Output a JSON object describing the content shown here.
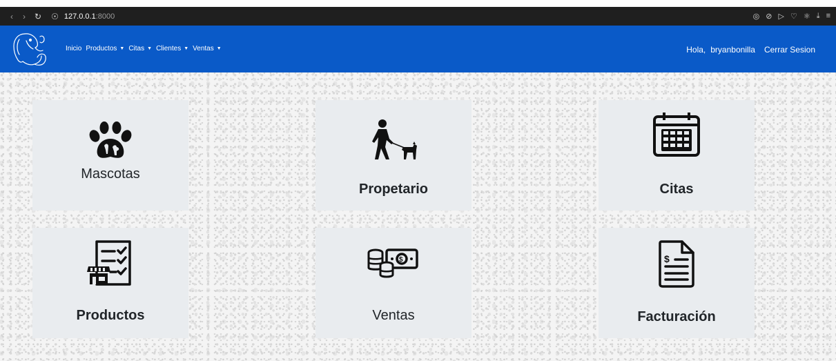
{
  "browser": {
    "back_icon": "chevron-left-icon",
    "forward_icon": "chevron-right-icon",
    "reload_icon": "reload-icon",
    "site_icon": "globe-icon",
    "url_host": "127.0.0.1",
    "url_port": ":8000"
  },
  "navbar": {
    "color": "#0a5ac8",
    "links": [
      {
        "label": "Inicio"
      },
      {
        "label": "Productos"
      },
      {
        "label": "Citas"
      },
      {
        "label": "Clientes"
      },
      {
        "label": "Ventas"
      }
    ],
    "greeting": "Hola,",
    "username": "bryanbonilla",
    "logout": "Cerrar Sesion"
  },
  "cards": [
    {
      "title": "Mascotas",
      "icon": "paw-icon"
    },
    {
      "title": "Propetario",
      "icon": "dog-walker-icon"
    },
    {
      "title": "Citas",
      "icon": "calendar-icon"
    },
    {
      "title": "Productos",
      "icon": "checklist-store-icon"
    },
    {
      "title": "Ventas",
      "icon": "money-icon"
    },
    {
      "title": "Facturación",
      "icon": "invoice-icon"
    }
  ]
}
